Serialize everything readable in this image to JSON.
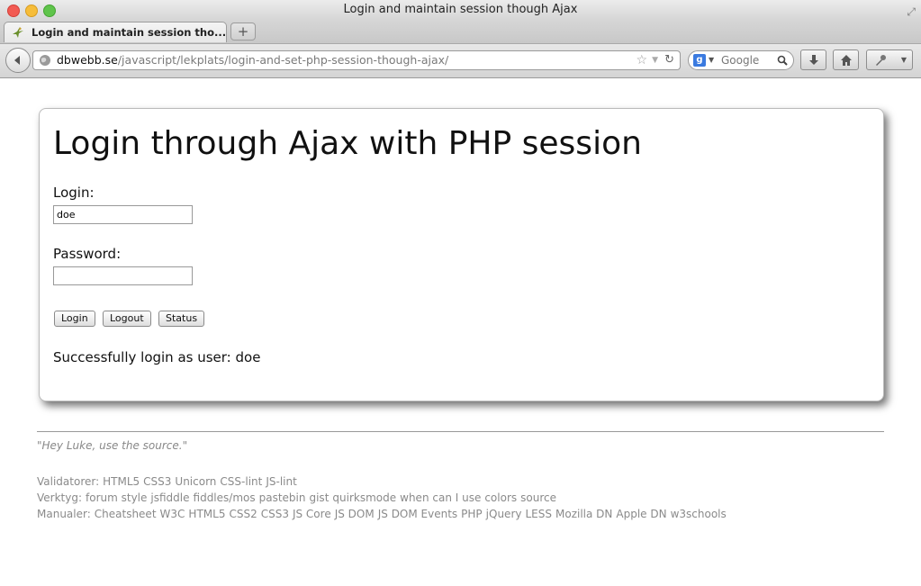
{
  "window": {
    "title": "Login and maintain session though Ajax"
  },
  "tabs": [
    {
      "label": "Login and maintain session tho..."
    }
  ],
  "newtab_label": "+",
  "address": {
    "domain": "dbwebb.se",
    "path": "/javascript/lekplats/login-and-set-php-session-though-ajax/"
  },
  "search": {
    "engine_letter": "g",
    "placeholder": "Google"
  },
  "icons": {
    "back": "back-arrow-icon",
    "globe": "globe-icon",
    "star": "bookmark-star-icon",
    "reload": "reload-icon",
    "search": "magnifier-icon",
    "download": "download-icon",
    "home": "home-icon",
    "tools": "tools-icon"
  },
  "page": {
    "heading": "Login through Ajax with PHP session",
    "login_label": "Login:",
    "login_value": "doe",
    "password_label": "Password:",
    "password_value": "",
    "buttons": {
      "login": "Login",
      "logout": "Logout",
      "status": "Status"
    },
    "status_message": "Successfully login as user: doe"
  },
  "footer": {
    "quote": "\"Hey Luke, use the source.\"",
    "validators_label": "Validatorer:",
    "validators": [
      "HTML5",
      "CSS3",
      "Unicorn",
      "CSS-lint",
      "JS-lint"
    ],
    "tools_label": "Verktyg:",
    "tools": [
      "forum style",
      "jsfiddle",
      "fiddles/mos",
      "pastebin",
      "gist",
      "quirksmode",
      "when can I use",
      "colors",
      "source"
    ],
    "manuals_label": "Manualer:",
    "manuals": [
      "Cheatsheet",
      "W3C",
      "HTML5",
      "CSS2",
      "CSS3",
      "JS Core",
      "JS DOM",
      "JS DOM Events",
      "PHP",
      "jQuery",
      "LESS",
      "Mozilla DN",
      "Apple DN",
      "w3schools"
    ]
  }
}
